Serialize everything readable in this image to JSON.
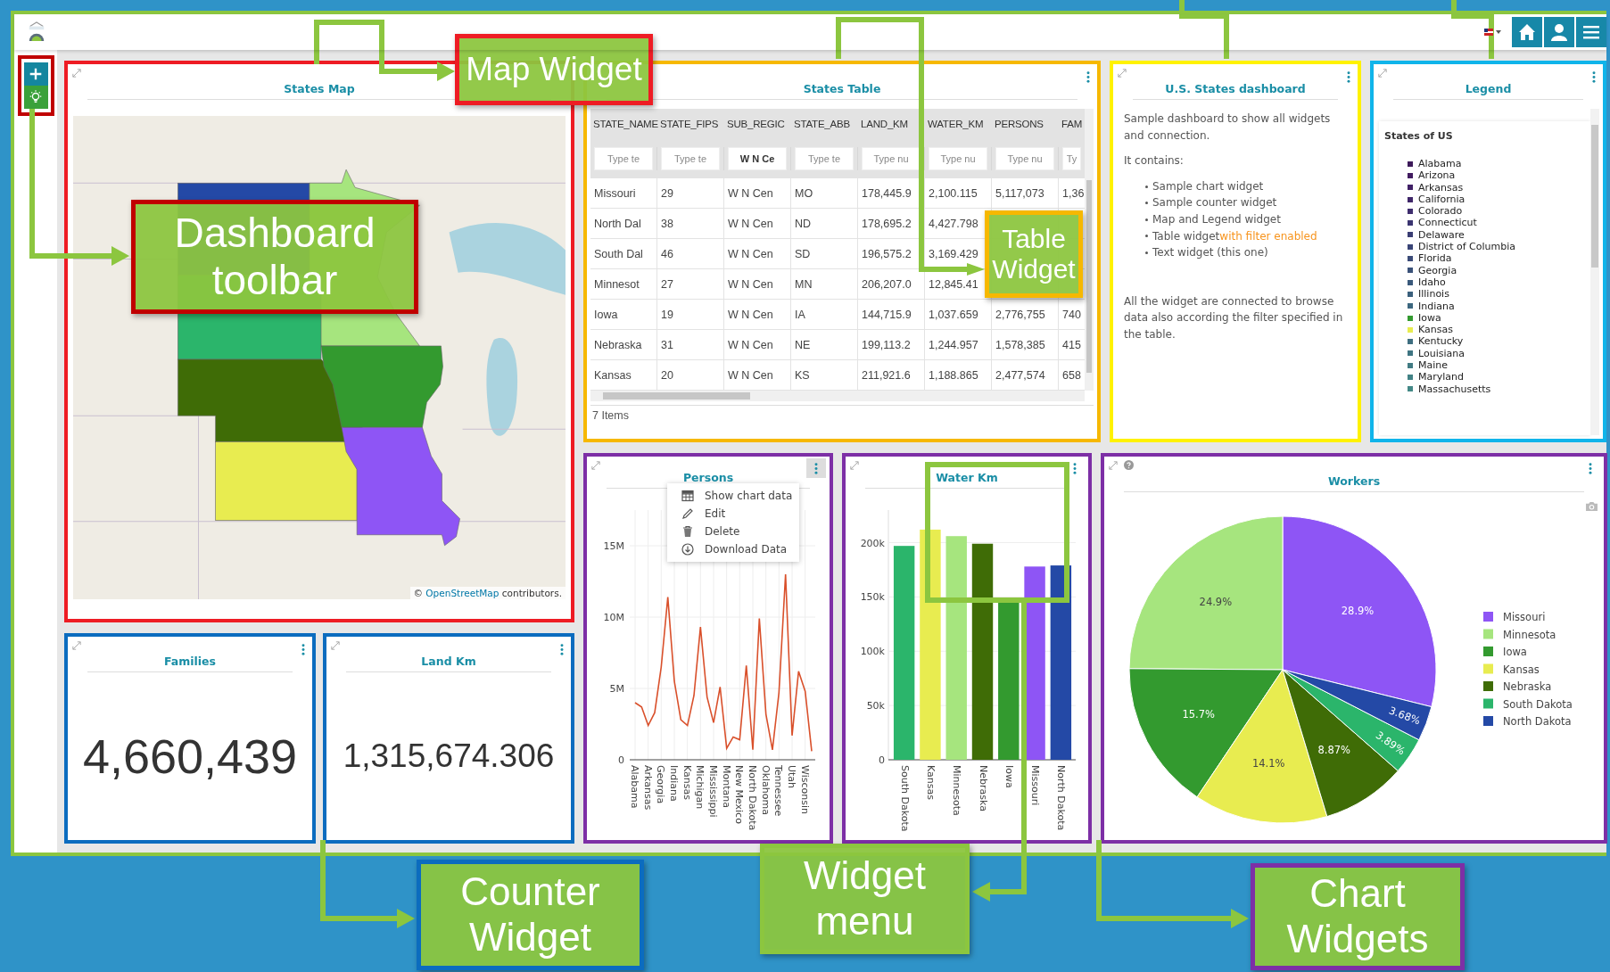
{
  "map_widget": {
    "title": "States Map",
    "attribution": {
      "prefix": "©",
      "link": "OpenStreetMap",
      "suffix": "contributors."
    }
  },
  "table_widget": {
    "title": "States Table",
    "columns": [
      "STATE_NAME",
      "STATE_FIPS",
      "SUB_REGIC",
      "STATE_ABB",
      "LAND_KM",
      "WATER_KM",
      "PERSONS",
      "FAM"
    ],
    "filters": [
      {
        "placeholder": "Type te"
      },
      {
        "placeholder": "Type te"
      },
      {
        "value": "W N Ce"
      },
      {
        "placeholder": "Type te"
      },
      {
        "placeholder": "Type nu"
      },
      {
        "placeholder": "Type nu"
      },
      {
        "placeholder": "Type nu"
      },
      {
        "placeholder": "Ty"
      }
    ],
    "rows": [
      [
        "Missouri",
        "29",
        "W N Cen",
        "MO",
        "178,445.9",
        "2,100.115",
        "5,117,073",
        "1,36"
      ],
      [
        "North Dal",
        "38",
        "W N Cen",
        "ND",
        "178,695.2",
        "4,427.798"
      ],
      [
        "South Dal",
        "46",
        "W N Cen",
        "SD",
        "196,575.2",
        "3,169.429"
      ],
      [
        "Minnesot",
        "27",
        "W N Cen",
        "MN",
        "206,207.0",
        "12,845.41"
      ],
      [
        "Iowa",
        "19",
        "W N Cen",
        "IA",
        "144,715.9",
        "1,037.659",
        "2,776,755",
        "740"
      ],
      [
        "Nebraska",
        "31",
        "W N Cen",
        "NE",
        "199,113.2",
        "1,244.957",
        "1,578,385",
        "415"
      ],
      [
        "Kansas",
        "20",
        "W N Cen",
        "KS",
        "211,921.6",
        "1,188.865",
        "2,477,574",
        "658"
      ]
    ],
    "footer": "7 Items"
  },
  "text_widget": {
    "title": "U.S. States dashboard",
    "intro": "Sample dashboard to show all widgets and connection.",
    "lead": "It contains:",
    "items": [
      {
        "text": "Sample chart widget"
      },
      {
        "text": "Sample counter widget"
      },
      {
        "text": "Map and Legend widget"
      },
      {
        "text": "Table widget",
        "emphasis": "with filter enabled"
      },
      {
        "text": "Text widget (this one)"
      }
    ],
    "outro": "All the widget are connected to browse data also according the filter specified in the table."
  },
  "legend_widget": {
    "title": "Legend",
    "heading": "States of US",
    "items": [
      {
        "label": "Alabama",
        "color": "#3d1a5a"
      },
      {
        "label": "Arizona",
        "color": "#411c60"
      },
      {
        "label": "Arkansas",
        "color": "#402066"
      },
      {
        "label": "California",
        "color": "#3f2669"
      },
      {
        "label": "Colorado",
        "color": "#3e2d6e"
      },
      {
        "label": "Connecticut",
        "color": "#3b3571"
      },
      {
        "label": "Delaware",
        "color": "#3a3d74"
      },
      {
        "label": "District of Columbia",
        "color": "#394476"
      },
      {
        "label": "Florida",
        "color": "#3b4b78"
      },
      {
        "label": "Georgia",
        "color": "#3a5279"
      },
      {
        "label": "Idaho",
        "color": "#3a597b"
      },
      {
        "label": "Illinois",
        "color": "#3b607d"
      },
      {
        "label": "Indiana",
        "color": "#3c677f"
      },
      {
        "label": "Iowa",
        "color": "#339a2f"
      },
      {
        "label": "Kansas",
        "color": "#e8ec50"
      },
      {
        "label": "Kentucky",
        "color": "#3e6e80"
      },
      {
        "label": "Louisiana",
        "color": "#3f7582"
      },
      {
        "label": "Maine",
        "color": "#417b83"
      },
      {
        "label": "Maryland",
        "color": "#428285"
      },
      {
        "label": "Massachusetts",
        "color": "#438886"
      }
    ]
  },
  "counters": [
    {
      "title": "Families",
      "value": "4,660,439"
    },
    {
      "title": "Land Km",
      "value": "1,315,674.306"
    }
  ],
  "charts": [
    {
      "title": "Persons",
      "menu_open": true,
      "menu": [
        {
          "kind": "table",
          "label": "Show chart data"
        },
        {
          "kind": "pencil",
          "label": "Edit"
        },
        {
          "kind": "trash",
          "label": "Delete"
        },
        {
          "kind": "download",
          "label": "Download Data"
        }
      ],
      "chart_data": {
        "type": "line",
        "grid": true,
        "ylim": [
          0,
          17500000
        ],
        "categories": [
          "Alabama",
          null,
          "Arkansas",
          null,
          "Georgia",
          null,
          "Indiana",
          null,
          "Kansas",
          null,
          "Michigan",
          null,
          "Mississippi",
          null,
          "Montana",
          null,
          "New Mexico",
          null,
          "North Dakota",
          null,
          "Oklahoma",
          null,
          "Tennessee",
          null,
          "Utah",
          null,
          "Wisconsin",
          null
        ],
        "yticks": [
          {
            "value": 0,
            "label": "0"
          },
          {
            "value": 5000000,
            "label": "5M"
          },
          {
            "value": 10000000,
            "label": "10M"
          },
          {
            "value": 15000000,
            "label": "15M"
          }
        ],
        "series": [
          {
            "color": "#d9502b",
            "values": [
              4000000,
              3700000,
              2400000,
              3300000,
              6500000,
              11400000,
              5500000,
              2800000,
              2400000,
              4500000,
              9300000,
              4400000,
              2600000,
              5100000,
              800000,
              1600000,
              1400000,
              6600000,
              700000,
              9900000,
              3200000,
              700000,
              4700000,
              13000000,
              1700000,
              6200000,
              4800000,
              600000
            ]
          }
        ]
      }
    },
    {
      "title": "Water Km",
      "menu_open": false,
      "chart_data": {
        "type": "bar",
        "grid": true,
        "ylim": [
          0,
          230000
        ],
        "categories": [
          "South Dakota",
          "Kansas",
          "Minnesota",
          "Nebraska",
          "Iowa",
          "Missouri",
          "North Dakota"
        ],
        "yticks": [
          {
            "value": 0,
            "label": "0"
          },
          {
            "value": 50000,
            "label": "50k"
          },
          {
            "value": 100000,
            "label": "100k"
          },
          {
            "value": 150000,
            "label": "150k"
          },
          {
            "value": 200000,
            "label": "200k"
          }
        ],
        "series": [
          {
            "colors": [
              "#2bb56b",
              "#e8ec50",
              "#a6e57e",
              "#3f6c06",
              "#339a2f",
              "#8e55f5",
              "#2449a6"
            ],
            "values": [
              197000,
              212000,
              206000,
              199000,
              145000,
              178000,
              179000
            ]
          }
        ]
      }
    },
    {
      "title": "Workers",
      "help": true,
      "menu_open": false,
      "chart_data": {
        "type": "pie",
        "legend": true,
        "categories": [
          "Missouri",
          "Minnesota",
          "Iowa",
          "Kansas",
          "Nebraska",
          "South Dakota",
          "North Dakota"
        ],
        "series": [
          {
            "colors": [
              "#8e55f5",
              "#a6e57e",
              "#339a2f",
              "#e8ec50",
              "#3f6c06",
              "#2bb56b",
              "#2449a6"
            ],
            "values": [
              28.9,
              24.9,
              15.7,
              14.1,
              8.87,
              3.89,
              3.68
            ]
          }
        ],
        "value_labels": [
          "28.9%",
          "24.9%",
          "15.7%",
          "14.1%",
          "8.87%",
          "3.89%",
          "3.68%"
        ]
      }
    }
  ],
  "callouts": [
    {
      "text": "Map Widget",
      "color": "#ee1c24"
    },
    {
      "text": "Dashboard toolbar",
      "color": "#c00000"
    },
    {
      "text": "Table Widget",
      "color": "#f6b800"
    },
    {
      "text": "Counter Widget",
      "color": "#0b6cbf"
    },
    {
      "text": "Widget menu",
      "color": "#8cc63f"
    },
    {
      "text": "Chart Widgets",
      "color": "#7d2fa6"
    }
  ]
}
